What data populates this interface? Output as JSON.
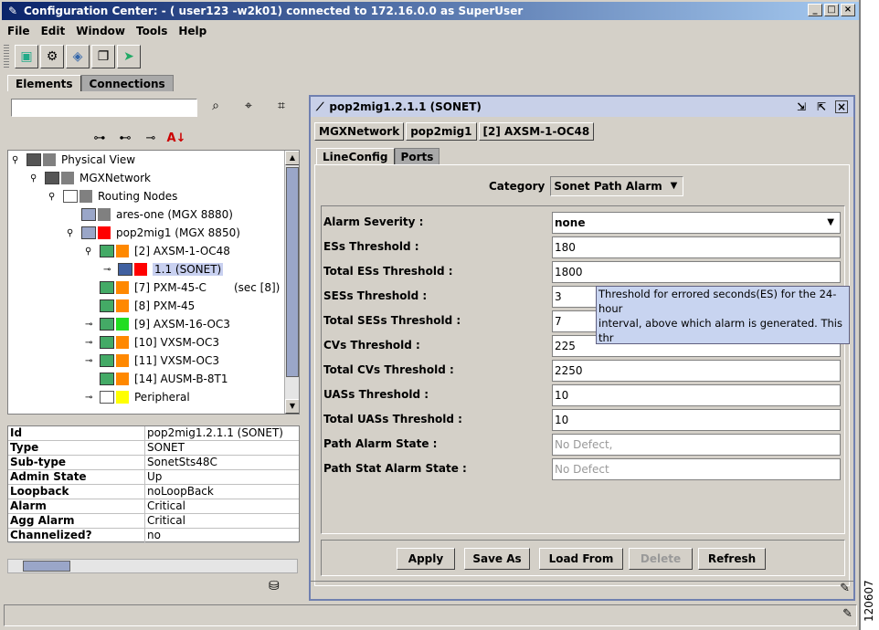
{
  "window": {
    "title": "Configuration Center: - ( user123 -w2k01) connected to  172.16.0.0   as SuperUser"
  },
  "menu": [
    "File",
    "Edit",
    "Window",
    "Tools",
    "Help"
  ],
  "main_tabs": [
    "Elements",
    "Connections"
  ],
  "tree": {
    "rows": [
      {
        "label": "Physical View"
      },
      {
        "label": "MGXNetwork"
      },
      {
        "label": "Routing Nodes"
      },
      {
        "label": "ares-one (MGX 8880)"
      },
      {
        "label": "pop2mig1 (MGX 8850)"
      },
      {
        "label": "[2] AXSM-1-OC48"
      },
      {
        "label": "1.1  (SONET)"
      },
      {
        "label": "[7] PXM-45-C",
        "extra": "(sec [8])"
      },
      {
        "label": "[8] PXM-45"
      },
      {
        "label": "[9] AXSM-16-OC3"
      },
      {
        "label": "[10] VXSM-OC3"
      },
      {
        "label": "[11] VXSM-OC3"
      },
      {
        "label": "[14] AUSM-B-8T1"
      },
      {
        "label": "Peripheral"
      }
    ]
  },
  "properties": [
    {
      "k": "Id",
      "v": "pop2mig1.2.1.1  (SONET)"
    },
    {
      "k": "Type",
      "v": "SONET"
    },
    {
      "k": "Sub-type",
      "v": "SonetSts48C"
    },
    {
      "k": "Admin State",
      "v": "Up"
    },
    {
      "k": "Loopback",
      "v": "noLoopBack"
    },
    {
      "k": "Alarm",
      "v": "Critical"
    },
    {
      "k": "Agg Alarm",
      "v": "Critical"
    },
    {
      "k": "Channelized?",
      "v": "no"
    }
  ],
  "detail": {
    "title": "pop2mig1.2.1.1  (SONET)",
    "breadcrumbs": [
      "MGXNetwork",
      "pop2mig1",
      "[2] AXSM-1-OC48"
    ],
    "tabs": [
      "LineConfig",
      "Ports"
    ],
    "category_label": "Category",
    "category_value": "Sonet Path Alarm",
    "fields": [
      {
        "label": "Alarm Severity :",
        "value": "none"
      },
      {
        "label": "ESs Threshold :",
        "value": "180"
      },
      {
        "label": "Total ESs Threshold :",
        "value": "1800"
      },
      {
        "label": "SESs Threshold :",
        "value": "3"
      },
      {
        "label": "Total SESs Threshold :",
        "value": "7"
      },
      {
        "label": "CVs Threshold :",
        "value": "225"
      },
      {
        "label": "Total CVs Threshold :",
        "value": "2250"
      },
      {
        "label": "UASs Threshold :",
        "value": "10"
      },
      {
        "label": "Total UASs Threshold :",
        "value": "10"
      },
      {
        "label": "Path Alarm State :",
        "value": "No Defect,"
      },
      {
        "label": "Path Stat Alarm State :",
        "value": "No Defect"
      }
    ],
    "tooltip": "Threshold for errored seconds(ES) for the 24-hour\ninterval, above which alarm is generated. This thr\neshold is the same for Far End (remote end of the\nline) and Near End(this end of the line).",
    "buttons": {
      "apply": "Apply",
      "save_as": "Save As",
      "load_from": "Load From",
      "delete": "Delete",
      "refresh": "Refresh"
    }
  },
  "side_number": "120607"
}
